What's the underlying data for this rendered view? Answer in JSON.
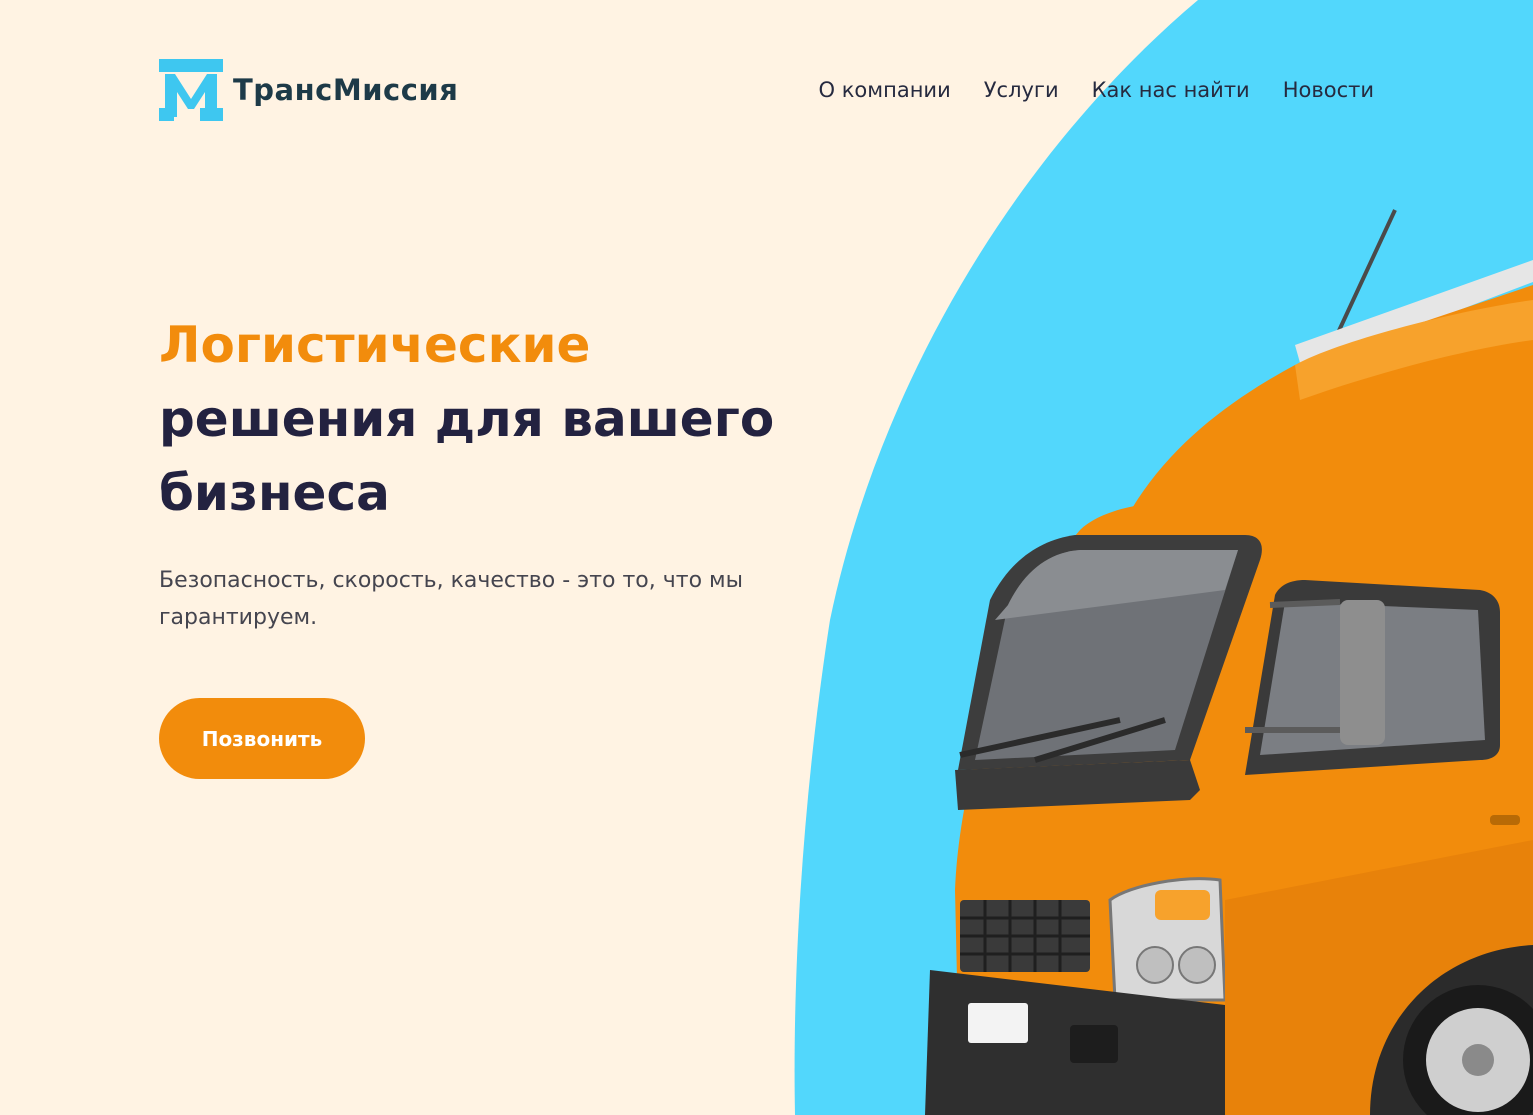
{
  "brand": {
    "name": "ТрансМиссия",
    "logo_icon": "m-logo-icon",
    "logo_color": "#3ec7f0",
    "text_color": "#1d3a48"
  },
  "nav": {
    "items": [
      {
        "label": "О компании"
      },
      {
        "label": "Услуги"
      },
      {
        "label": "Как нас найти"
      },
      {
        "label": "Новости"
      }
    ]
  },
  "hero": {
    "headline_accent": "Логистические",
    "headline_rest": "решения для вашего бизнеса",
    "subtitle": "Безопасность, скорость, качество - это то, что мы гарантируем.",
    "cta_label": "Позвонить",
    "image": "orange-truck-illustration"
  },
  "colors": {
    "background": "#fff3e3",
    "accent": "#f28c0c",
    "sky_blue": "#52d7fc",
    "heading_dark": "#232240"
  }
}
